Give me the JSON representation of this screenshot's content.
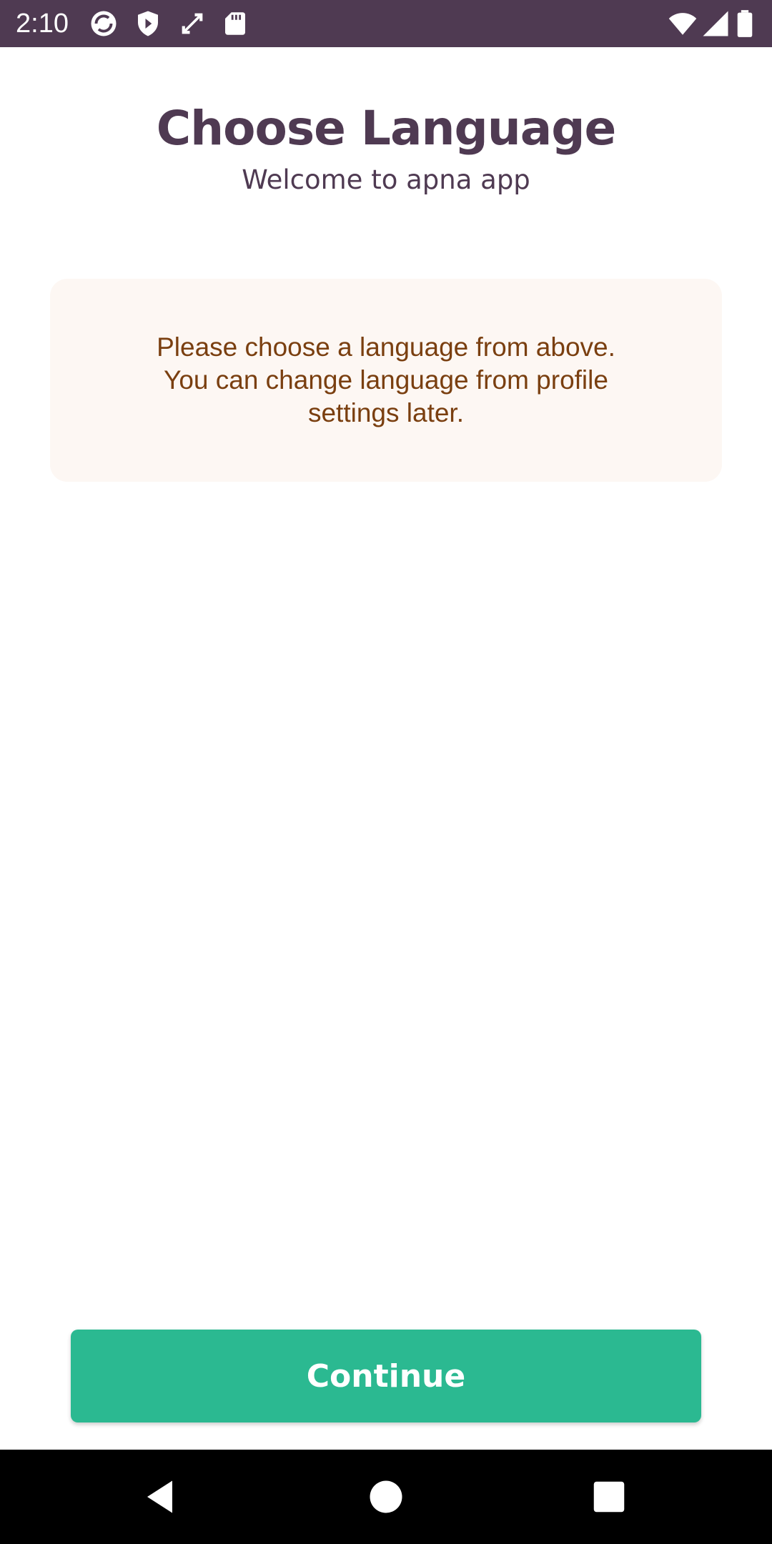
{
  "status_bar": {
    "time": "2:10",
    "icons": [
      "sync-icon",
      "shield-icon",
      "expand-icon",
      "sd-card-icon",
      "wifi-icon",
      "signal-icon",
      "battery-icon"
    ],
    "background": "#4f3a52"
  },
  "header": {
    "title": "Choose Language",
    "subtitle": "Welcome to apna app"
  },
  "info_card": {
    "message": "Please choose a language from above.\nYou can change language from profile\nsettings later.",
    "background": "#fdf7f3",
    "text_color": "#7a3f10"
  },
  "actions": {
    "continue_label": "Continue",
    "continue_color": "#2bb991"
  },
  "nav_bar": {
    "buttons": [
      "back-icon",
      "home-icon",
      "recents-icon"
    ]
  }
}
